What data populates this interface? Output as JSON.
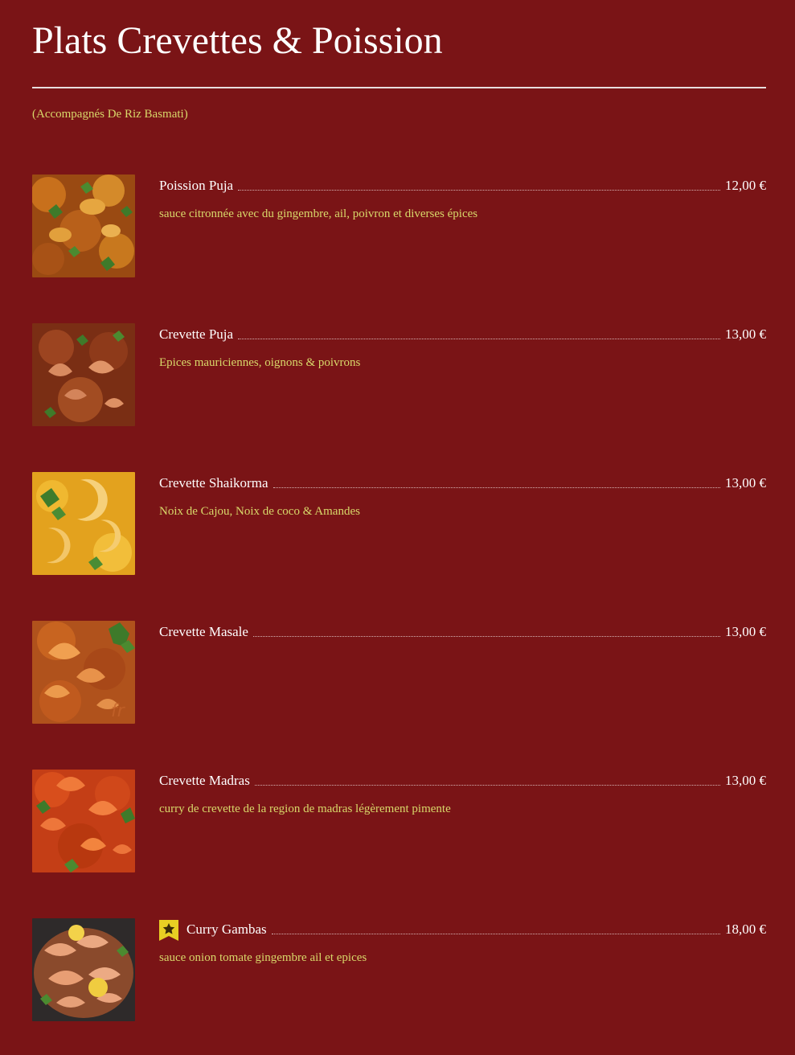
{
  "page": {
    "title": "Plats Crevettes & Poission",
    "subtitle": "(Accompagnés De Riz Basmati)",
    "watermark": "fr"
  },
  "colors": {
    "background": "#7a1416",
    "title_text": "#ffffff",
    "accent_text": "#d8d86a",
    "rule": "#e8dede",
    "badge": "#e8cf23"
  },
  "items": [
    {
      "name": "Poission Puja",
      "price": "12,00 €",
      "description": "sauce citronnée avec du gingembre, ail, poivron et diverses épices",
      "image": "fish-curry-photo",
      "featured": false
    },
    {
      "name": "Crevette Puja",
      "price": "13,00 €",
      "description": "Epices mauriciennes, oignons & poivrons",
      "image": "shrimp-curry-photo",
      "featured": false
    },
    {
      "name": "Crevette Shaikorma",
      "price": "13,00 €",
      "description": "Noix de Cajou, Noix de coco & Amandes",
      "image": "shrimp-korma-photo",
      "featured": false
    },
    {
      "name": "Crevette Masale",
      "price": "13,00 €",
      "description": "",
      "image": "shrimp-masala-photo",
      "featured": false
    },
    {
      "name": "Crevette Madras",
      "price": "13,00 €",
      "description": "curry de crevette de la region de madras légèrement pimente",
      "image": "shrimp-madras-photo",
      "featured": false
    },
    {
      "name": "Curry Gambas",
      "price": "18,00 €",
      "description": "sauce onion tomate gingembre ail et epices",
      "image": "gambas-curry-photo",
      "featured": true,
      "badge_icon": "star-badge-icon"
    }
  ]
}
